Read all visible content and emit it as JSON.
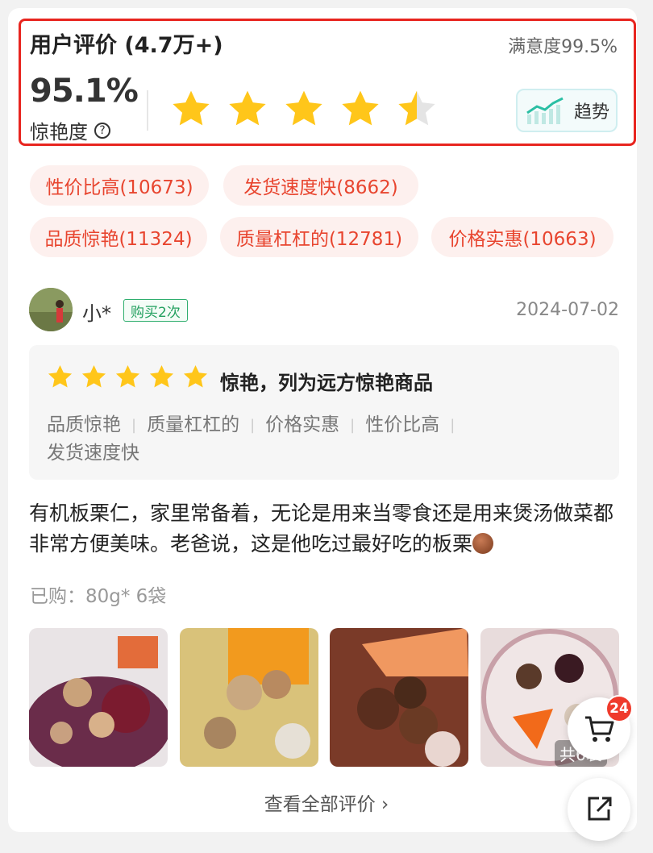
{
  "header": {
    "title": "用户评价 (4.7万+)",
    "satisfaction": "满意度99.5%",
    "wow_percent": "95.1%",
    "wow_label": "惊艳度",
    "help_icon": "question-circle-icon",
    "star_rating": 4.5,
    "trend_label": "趋势"
  },
  "tags": [
    {
      "label": "性价比高(10673)"
    },
    {
      "label": "发货速度快(8662)"
    },
    {
      "label": "品质惊艳(11324)"
    },
    {
      "label": "质量杠杠的(12781)"
    },
    {
      "label": "价格实惠(10663)"
    }
  ],
  "review": {
    "user": "小*",
    "badge": "购买2次",
    "date": "2024-07-02",
    "stars": 5,
    "headline": "惊艳，列为远方惊艳商品",
    "tags": [
      "品质惊艳",
      "质量杠杠的",
      "价格实惠",
      "性价比高",
      "发货速度快"
    ],
    "tag_separator": "|",
    "text": "有机板栗仁，家里常备着，无论是用来当零食还是用来煲汤做菜都非常方便美味。老爸说，这是他吃过最好吃的板栗",
    "purchased": "已购：80g* 6袋",
    "photos": [
      "photo-1",
      "photo-2",
      "photo-3",
      "photo-4"
    ],
    "photos_overlay": "共6袋"
  },
  "footer": {
    "view_all": "查看全部评价",
    "chevron": "›"
  },
  "floating": {
    "cart_count": "24",
    "cart_icon": "cart-icon",
    "share_icon": "share-icon"
  },
  "colors": {
    "highlight_border": "#e8251f",
    "tag_bg": "#fdf0ee",
    "tag_text": "#e8452f",
    "badge_green": "#23a05f",
    "star": "#ffc61a"
  }
}
